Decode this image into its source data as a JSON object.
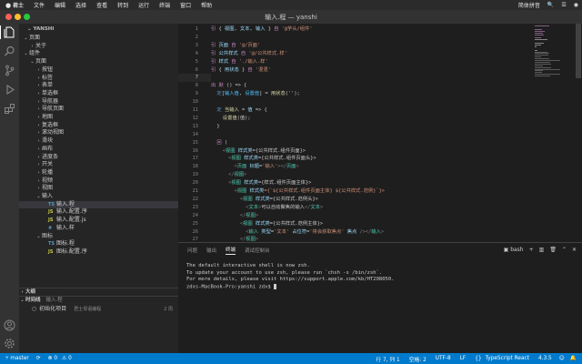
{
  "menubar": {
    "apple": "",
    "items": [
      "君士",
      "文件",
      "编辑",
      "选择",
      "查看",
      "转到",
      "运行",
      "终端",
      "窗口",
      "帮助"
    ],
    "right_items": [
      "简体拼音",
      "🔍",
      "☰",
      "◉"
    ]
  },
  "window": {
    "title": "输入.程 — yanshi"
  },
  "colors": {
    "accent": "#007acc",
    "keyword": "#569cd6",
    "tag": "#4ec9b0",
    "string": "#ce9178",
    "attr": "#9cdcfe",
    "comment": "#6a9955",
    "control": "#c586c0",
    "func": "#dcdcaa"
  },
  "sidebar": {
    "header": "YANSHI",
    "tree": [
      {
        "label": "页面",
        "depth": 1,
        "chev": "⌄",
        "icon": "",
        "color": "#cccccc"
      },
      {
        "label": "关于",
        "depth": 2,
        "chev": "›",
        "icon": "",
        "color": "#cccccc"
      },
      {
        "label": "组件",
        "depth": 1,
        "chev": "⌄",
        "icon": "",
        "color": "#cccccc"
      },
      {
        "label": "页面",
        "depth": 2,
        "chev": "⌄",
        "icon": "",
        "color": "#cccccc"
      },
      {
        "label": "按钮",
        "depth": 3,
        "chev": "›",
        "icon": "",
        "color": "#cccccc"
      },
      {
        "label": "标签",
        "depth": 3,
        "chev": "›",
        "icon": "",
        "color": "#cccccc"
      },
      {
        "label": "表单",
        "depth": 3,
        "chev": "›",
        "icon": "",
        "color": "#cccccc"
      },
      {
        "label": "单选框",
        "depth": 3,
        "chev": "›",
        "icon": "",
        "color": "#cccccc"
      },
      {
        "label": "导航器",
        "depth": 3,
        "chev": "›",
        "icon": "",
        "color": "#cccccc"
      },
      {
        "label": "导航页面",
        "depth": 3,
        "chev": "›",
        "icon": "",
        "color": "#cccccc"
      },
      {
        "label": "地图",
        "depth": 3,
        "chev": "›",
        "icon": "",
        "color": "#cccccc"
      },
      {
        "label": "复选框",
        "depth": 3,
        "chev": "›",
        "icon": "",
        "color": "#cccccc"
      },
      {
        "label": "滚动视图",
        "depth": 3,
        "chev": "›",
        "icon": "",
        "color": "#cccccc"
      },
      {
        "label": "滑块",
        "depth": 3,
        "chev": "›",
        "icon": "",
        "color": "#cccccc"
      },
      {
        "label": "画布",
        "depth": 3,
        "chev": "›",
        "icon": "",
        "color": "#cccccc"
      },
      {
        "label": "进度条",
        "depth": 3,
        "chev": "›",
        "icon": "",
        "color": "#cccccc"
      },
      {
        "label": "开关",
        "depth": 3,
        "chev": "›",
        "icon": "",
        "color": "#cccccc"
      },
      {
        "label": "轮播",
        "depth": 3,
        "chev": "›",
        "icon": "",
        "color": "#cccccc"
      },
      {
        "label": "视频",
        "depth": 3,
        "chev": "›",
        "icon": "",
        "color": "#cccccc"
      },
      {
        "label": "视图",
        "depth": 3,
        "chev": "›",
        "icon": "",
        "color": "#cccccc"
      },
      {
        "label": "输入",
        "depth": 3,
        "chev": "⌄",
        "icon": "",
        "color": "#cccccc"
      },
      {
        "label": "输入.程",
        "depth": 4,
        "chev": "",
        "icon": "TS",
        "icon_color": "#519aba",
        "color": "#cccccc",
        "selected": true
      },
      {
        "label": "输入.配置.序",
        "depth": 4,
        "chev": "",
        "icon": "JS",
        "icon_color": "#cbcb41",
        "color": "#cccccc"
      },
      {
        "label": "输入.配置.js",
        "depth": 4,
        "chev": "",
        "icon": "JS",
        "icon_color": "#cbcb41",
        "color": "#cccccc"
      },
      {
        "label": "输入.样",
        "depth": 4,
        "chev": "",
        "icon": "#",
        "icon_color": "#519aba",
        "color": "#cccccc"
      },
      {
        "label": "图标",
        "depth": 3,
        "chev": "⌄",
        "icon": "",
        "color": "#cccccc"
      },
      {
        "label": "图标.程",
        "depth": 4,
        "chev": "",
        "icon": "TS",
        "icon_color": "#519aba",
        "color": "#cccccc"
      },
      {
        "label": "图标.配置.序",
        "depth": 4,
        "chev": "",
        "icon": "JS",
        "icon_color": "#cbcb41",
        "color": "#cccccc"
      }
    ],
    "outline_label": "大纲",
    "timeline_label": "时间线",
    "timeline_file": "输入.程",
    "timeline_entry": {
      "text": "初始化项目",
      "author": "君士母语编程",
      "age": "2 周"
    }
  },
  "editor": {
    "lines": [
      {
        "n": 1,
        "seg": [
          [
            "引 ",
            "#c586c0"
          ],
          [
            "{ ",
            "#cccccc"
          ],
          [
            "视图",
            "#9cdcfe"
          ],
          [
            ", ",
            "#cccccc"
          ],
          [
            "文本",
            "#9cdcfe"
          ],
          [
            ", ",
            "#cccccc"
          ],
          [
            "输入",
            "#9cdcfe"
          ],
          [
            " } ",
            "#cccccc"
          ],
          [
            "自 ",
            "#c586c0"
          ],
          [
            "'@芋头/组件'",
            "#ce9178"
          ]
        ]
      },
      {
        "n": 2,
        "seg": []
      },
      {
        "n": 3,
        "seg": [
          [
            "引 ",
            "#c586c0"
          ],
          [
            "页面 ",
            "#9cdcfe"
          ],
          [
            "自 ",
            "#c586c0"
          ],
          [
            "'@/页面'",
            "#ce9178"
          ]
        ]
      },
      {
        "n": 4,
        "seg": [
          [
            "引 ",
            "#c586c0"
          ],
          [
            "公共样式 ",
            "#9cdcfe"
          ],
          [
            "自 ",
            "#c586c0"
          ],
          [
            "'@/公共样式.样'",
            "#ce9178"
          ]
        ]
      },
      {
        "n": 5,
        "seg": [
          [
            "引 ",
            "#c586c0"
          ],
          [
            "样式 ",
            "#9cdcfe"
          ],
          [
            "自 ",
            "#c586c0"
          ],
          [
            "'./输入.样'",
            "#ce9178"
          ]
        ]
      },
      {
        "n": 6,
        "seg": [
          [
            "引 ",
            "#c586c0"
          ],
          [
            "{ ",
            "#cccccc"
          ],
          [
            "用状态",
            "#9cdcfe"
          ],
          [
            " } ",
            "#cccccc"
          ],
          [
            "自 ",
            "#c586c0"
          ],
          [
            "'混混'",
            "#ce9178"
          ]
        ]
      },
      {
        "n": 7,
        "seg": []
      },
      {
        "n": 8,
        "seg": [
          [
            "出 ",
            "#c586c0"
          ],
          [
            "默 ",
            "#c586c0"
          ],
          [
            "() => {",
            "#cccccc"
          ]
        ]
      },
      {
        "n": 9,
        "seg": [
          [
            "  ",
            "#cccccc"
          ],
          [
            "定",
            "#569cd6"
          ],
          [
            "[",
            "#cccccc"
          ],
          [
            "输入值",
            "#4fc1ff"
          ],
          [
            ", ",
            "#cccccc"
          ],
          [
            "设置值",
            "#4fc1ff"
          ],
          [
            "] = ",
            "#cccccc"
          ],
          [
            "用状态",
            "#dcdcaa"
          ],
          [
            "('');",
            "#cccccc"
          ]
        ]
      },
      {
        "n": 10,
        "seg": []
      },
      {
        "n": 11,
        "seg": [
          [
            "  ",
            "#cccccc"
          ],
          [
            "定 ",
            "#569cd6"
          ],
          [
            "当输入 ",
            "#dcdcaa"
          ],
          [
            "= ",
            "#cccccc"
          ],
          [
            "值 ",
            "#9cdcfe"
          ],
          [
            "=> {",
            "#cccccc"
          ]
        ]
      },
      {
        "n": 12,
        "seg": [
          [
            "    ",
            "#cccccc"
          ],
          [
            "设置值",
            "#dcdcaa"
          ],
          [
            "(值);",
            "#cccccc"
          ]
        ]
      },
      {
        "n": 13,
        "seg": [
          [
            "  }",
            "#cccccc"
          ]
        ]
      },
      {
        "n": 14,
        "seg": []
      },
      {
        "n": 15,
        "seg": [
          [
            "  ",
            "#cccccc"
          ],
          [
            "回 ",
            "#c586c0"
          ],
          [
            "(",
            "#cccccc"
          ]
        ]
      },
      {
        "n": 16,
        "seg": [
          [
            "    <",
            "#808080"
          ],
          [
            "视图 ",
            "#4ec9b0"
          ],
          [
            "样式类",
            "#9cdcfe"
          ],
          [
            "={公共样式.组件页面}>",
            "#cccccc"
          ]
        ]
      },
      {
        "n": 17,
        "seg": [
          [
            "      <",
            "#808080"
          ],
          [
            "视图 ",
            "#4ec9b0"
          ],
          [
            "样式类",
            "#9cdcfe"
          ],
          [
            "={公共样式.组件页面头}>",
            "#cccccc"
          ]
        ]
      },
      {
        "n": 18,
        "seg": [
          [
            "        <",
            "#808080"
          ],
          [
            "页面 ",
            "#4ec9b0"
          ],
          [
            "标题",
            "#9cdcfe"
          ],
          [
            "=",
            "#cccccc"
          ],
          [
            "'输入'",
            "#ce9178"
          ],
          [
            "></",
            "#808080"
          ],
          [
            "页面",
            "#4ec9b0"
          ],
          [
            ">",
            "#808080"
          ]
        ]
      },
      {
        "n": 19,
        "seg": [
          [
            "      </",
            "#808080"
          ],
          [
            "视图",
            "#4ec9b0"
          ],
          [
            ">",
            "#808080"
          ]
        ]
      },
      {
        "n": 20,
        "seg": [
          [
            "      <",
            "#808080"
          ],
          [
            "视图 ",
            "#4ec9b0"
          ],
          [
            "样式类",
            "#9cdcfe"
          ],
          [
            "={样式.组件页面主体}>",
            "#cccccc"
          ]
        ]
      },
      {
        "n": 21,
        "seg": [
          [
            "        <",
            "#808080"
          ],
          [
            "视图 ",
            "#4ec9b0"
          ],
          [
            "样式类",
            "#9cdcfe"
          ],
          [
            "={`${公共样式.组件页面主体} ${公共样式.范例}`}>",
            "#ce9178"
          ]
        ]
      },
      {
        "n": 22,
        "seg": [
          [
            "          <",
            "#808080"
          ],
          [
            "视图 ",
            "#4ec9b0"
          ],
          [
            "样式类",
            "#9cdcfe"
          ],
          [
            "={公共样式.范例头}>",
            "#cccccc"
          ]
        ]
      },
      {
        "n": 23,
        "seg": [
          [
            "            <",
            "#808080"
          ],
          [
            "文本",
            "#4ec9b0"
          ],
          [
            ">",
            "#808080"
          ],
          [
            "可以自动聚焦的输入",
            "#cccccc"
          ],
          [
            "</",
            "#808080"
          ],
          [
            "文本",
            "#4ec9b0"
          ],
          [
            ">",
            "#808080"
          ]
        ]
      },
      {
        "n": 24,
        "seg": [
          [
            "          </",
            "#808080"
          ],
          [
            "视图",
            "#4ec9b0"
          ],
          [
            ">",
            "#808080"
          ]
        ]
      },
      {
        "n": 25,
        "seg": [
          [
            "          <",
            "#808080"
          ],
          [
            "视图 ",
            "#4ec9b0"
          ],
          [
            "样式类",
            "#9cdcfe"
          ],
          [
            "={公共样式.范例主体}>",
            "#cccccc"
          ]
        ]
      },
      {
        "n": 26,
        "seg": [
          [
            "            <",
            "#808080"
          ],
          [
            "输入 ",
            "#4ec9b0"
          ],
          [
            "类型",
            "#9cdcfe"
          ],
          [
            "=",
            "#cccccc"
          ],
          [
            "'文本'",
            "#ce9178"
          ],
          [
            " 占位符",
            "#9cdcfe"
          ],
          [
            "=",
            "#cccccc"
          ],
          [
            "'将会获取焦点'",
            "#ce9178"
          ],
          [
            " 焦点 ",
            "#9cdcfe"
          ],
          [
            "/>",
            "#808080"
          ],
          [
            "</",
            "#808080"
          ],
          [
            "输入",
            "#4ec9b0"
          ],
          [
            ">",
            "#808080"
          ]
        ]
      },
      {
        "n": 27,
        "seg": [
          [
            "          </",
            "#808080"
          ],
          [
            "视图",
            "#4ec9b0"
          ],
          [
            ">",
            "#808080"
          ]
        ]
      },
      {
        "n": 28,
        "seg": [
          [
            "        </",
            "#808080"
          ],
          [
            "视图",
            "#4ec9b0"
          ],
          [
            ">",
            "#808080"
          ]
        ]
      },
      {
        "n": 29,
        "seg": [
          [
            "        <",
            "#808080"
          ],
          [
            "视图 ",
            "#4ec9b0"
          ],
          [
            "样式类",
            "#9cdcfe"
          ],
          [
            "={`${公共样式.组件页面主体} ${公共样式.范例}`}>",
            "#ce9178"
          ]
        ]
      },
      {
        "n": 30,
        "seg": [
          [
            "          <",
            "#808080"
          ],
          [
            "视图 ",
            "#4ec9b0"
          ],
          [
            "样式类",
            "#9cdcfe"
          ],
          [
            "={公共样式.范例头}>",
            "#cccccc"
          ]
        ]
      }
    ]
  },
  "terminal": {
    "tabs": [
      "问题",
      "输出",
      "终端",
      "调试控制台"
    ],
    "active_tab": "终端",
    "shell": "bash",
    "lines": [
      "The default interactive shell is now zsh.",
      "To update your account to use zsh, please run `chsh -s /bin/zsh`.",
      "For more details, please visit https://support.apple.com/kb/HT208050.",
      "zdxs-MacBook-Pro:yanshi zdx$ "
    ]
  },
  "statusbar": {
    "branch": "master",
    "errors": "⊗ 0",
    "warnings": "⚠ 0",
    "position": "行 7, 列 1",
    "spaces": "空格: 2",
    "encoding": "UTF-8",
    "eol": "LF",
    "language": "TypeScript React",
    "version": "4.3.5"
  }
}
